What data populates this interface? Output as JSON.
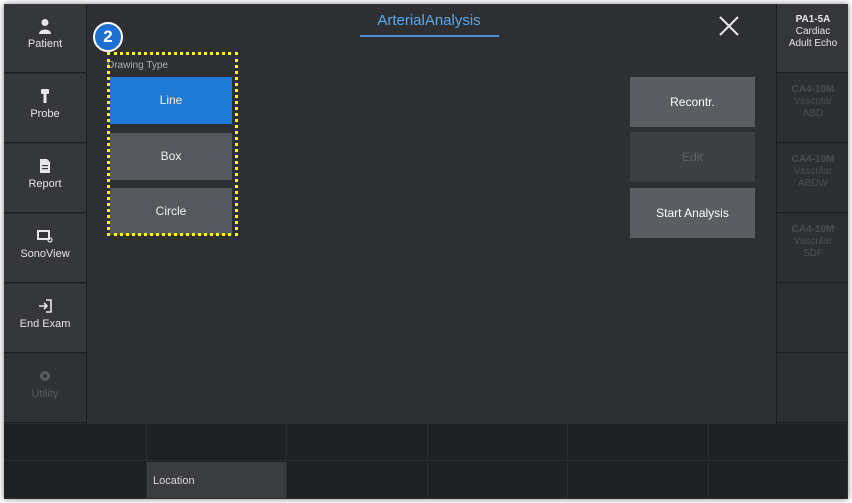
{
  "app": {
    "title": "ArterialAnalysis",
    "accent": "#1f7ad6",
    "badge_number": "2"
  },
  "sidebar": {
    "items": [
      {
        "label": "Patient",
        "icon": "person-icon",
        "enabled": true
      },
      {
        "label": "Probe",
        "icon": "probe-icon",
        "enabled": true
      },
      {
        "label": "Report",
        "icon": "report-icon",
        "enabled": true
      },
      {
        "label": "SonoView",
        "icon": "sonoview-icon",
        "enabled": true
      },
      {
        "label": "End Exam",
        "icon": "end-exam-icon",
        "enabled": true
      },
      {
        "label": "Utility",
        "icon": "gear-icon",
        "enabled": false
      }
    ]
  },
  "drawing": {
    "section_label": "Drawing Type",
    "buttons": [
      {
        "label": "Line",
        "active": true
      },
      {
        "label": "Box",
        "active": false
      },
      {
        "label": "Circle",
        "active": false
      }
    ]
  },
  "actions": {
    "recontr": "Recontr.",
    "edit": "Edit",
    "start": "Start Analysis"
  },
  "probes": [
    {
      "name": "PA1-5A",
      "line1": "Cardiac",
      "line2": "Adult Echo",
      "active": true
    },
    {
      "name": "CA4-10M",
      "line1": "Vascular",
      "line2": "ABD",
      "active": false
    },
    {
      "name": "CA4-10M",
      "line1": "Vascular",
      "line2": "ABDW",
      "active": false
    },
    {
      "name": "CA4-10M",
      "line1": "Vascular",
      "line2": "SDF",
      "active": false
    }
  ],
  "bottom": {
    "location_label": "Location"
  }
}
